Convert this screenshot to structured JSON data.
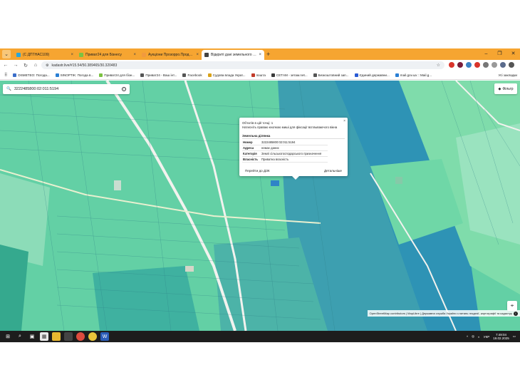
{
  "browser": {
    "tabs": [
      {
        "label": "(С ДПТНАС109)",
        "color": "#2aa6d9",
        "active": false
      },
      {
        "label": "Приват24 для Бізнесу",
        "color": "#7cc242",
        "active": false
      },
      {
        "label": "Аукціони Прозорро.Продажі",
        "color": "#f19a3e",
        "active": false
      },
      {
        "label": "Відкриті дані земельного кадастру",
        "color": "#444444",
        "active": true
      }
    ],
    "new_tab": "+",
    "url": "kadastr.live/#15.54/50.389465/30.320483"
  },
  "bookmarks": {
    "items": [
      {
        "label": "DSMETEO: Погода...",
        "color": "#3b6ec9"
      },
      {
        "label": "SINOPTIK: Погода в...",
        "color": "#2a7fd4"
      },
      {
        "label": "Приват24 для бізн...",
        "color": "#7cc242"
      },
      {
        "label": "Приват24 - Ваш інт...",
        "color": "#555555"
      },
      {
        "label": "Facebook",
        "color": "#555555"
      },
      {
        "label": "Судова влада Украї...",
        "color": "#d9a21a"
      },
      {
        "label": "пошта",
        "color": "#c23b2a"
      },
      {
        "label": "СЕТАМ - зетам.net...",
        "color": "#3a3a3a"
      },
      {
        "label": "Безкоштовний зап...",
        "color": "#555555"
      },
      {
        "label": "Єдиний державни...",
        "color": "#2a5bd4"
      },
      {
        "label": "mail.gov.ua :: Mail.g...",
        "color": "#2a7fd4"
      }
    ],
    "all_bookmarks": "Усі закладки"
  },
  "map": {
    "search_value": "3222485800:02:011:5194",
    "filters_label": "Фільтр",
    "attribution": "OpenStreetMap contributors | MapLibre | Державна служба України з питань геодезії, картографії та кадастру"
  },
  "popup": {
    "objects_count": "Об'єктів в цій точці: 1",
    "hint": "Натисніть праваю кнопкою миші для фіксації всплываючого вікна",
    "section_title": "Земельна ділянка",
    "rows": [
      {
        "key": "Номер",
        "value": "3222485800:02:011:5194"
      },
      {
        "key": "Адреса",
        "value": "немає даних"
      },
      {
        "key": "Категорія",
        "value": "Землі сільськогосподарського призначення"
      },
      {
        "key": "Власність",
        "value": "Приватна власність"
      }
    ],
    "go_dzk": "Перейти до ДЗК",
    "details": "Детальніше"
  },
  "taskbar": {
    "lang": "УКР",
    "time": "7:49:04",
    "date": "19.02.2025"
  }
}
